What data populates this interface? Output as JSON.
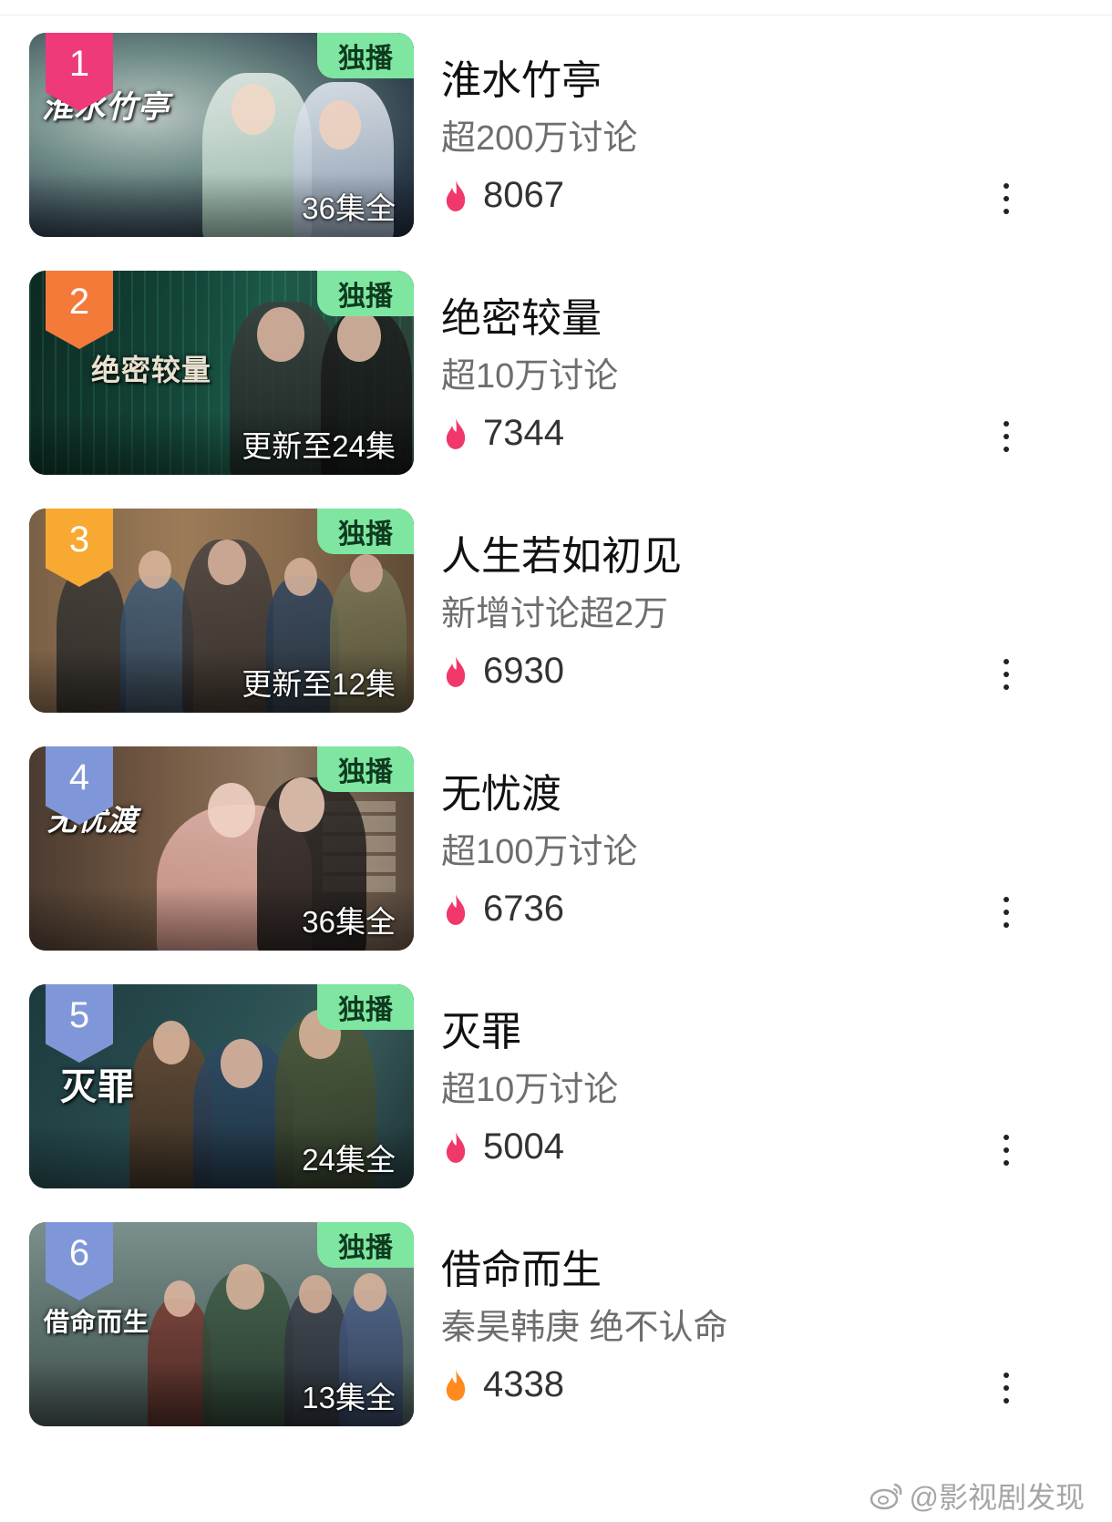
{
  "colors": {
    "exclusive_tag_bg": "#7ee6a0",
    "flame_hot": "#f0386b",
    "flame_warm": "#ff8a1f"
  },
  "items": [
    {
      "rank": "1",
      "rank_color": "#ee3a7a",
      "poster_title": "淮水竹亭",
      "exclusive": "独播",
      "episode_status": "36集全",
      "title": "淮水竹亭",
      "subtitle": "超200万讨论",
      "heat": "8067",
      "flame_color": "#f0386b"
    },
    {
      "rank": "2",
      "rank_color": "#f47a3a",
      "poster_title": "绝密较量",
      "exclusive": "独播",
      "episode_status": "更新至24集",
      "title": "绝密较量",
      "subtitle": "超10万讨论",
      "heat": "7344",
      "flame_color": "#f0386b"
    },
    {
      "rank": "3",
      "rank_color": "#f7a932",
      "poster_title": "",
      "exclusive": "独播",
      "episode_status": "更新至12集",
      "title": "人生若如初见",
      "subtitle": "新增讨论超2万",
      "heat": "6930",
      "flame_color": "#f0386b"
    },
    {
      "rank": "4",
      "rank_color": "#7f97d8",
      "poster_title": "无忧渡",
      "exclusive": "独播",
      "episode_status": "36集全",
      "title": "无忧渡",
      "subtitle": "超100万讨论",
      "heat": "6736",
      "flame_color": "#f0386b"
    },
    {
      "rank": "5",
      "rank_color": "#7f97d8",
      "poster_title": "灭罪",
      "exclusive": "独播",
      "episode_status": "24集全",
      "title": "灭罪",
      "subtitle": "超10万讨论",
      "heat": "5004",
      "flame_color": "#f0386b"
    },
    {
      "rank": "6",
      "rank_color": "#7f97d8",
      "poster_title": "借命而生",
      "exclusive": "独播",
      "episode_status": "13集全",
      "title": "借命而生",
      "subtitle": "秦昊韩庚 绝不认命",
      "heat": "4338",
      "flame_color": "#ff8a1f"
    }
  ],
  "watermark": {
    "text": "@影视剧发现",
    "icon": "weibo-icon"
  }
}
